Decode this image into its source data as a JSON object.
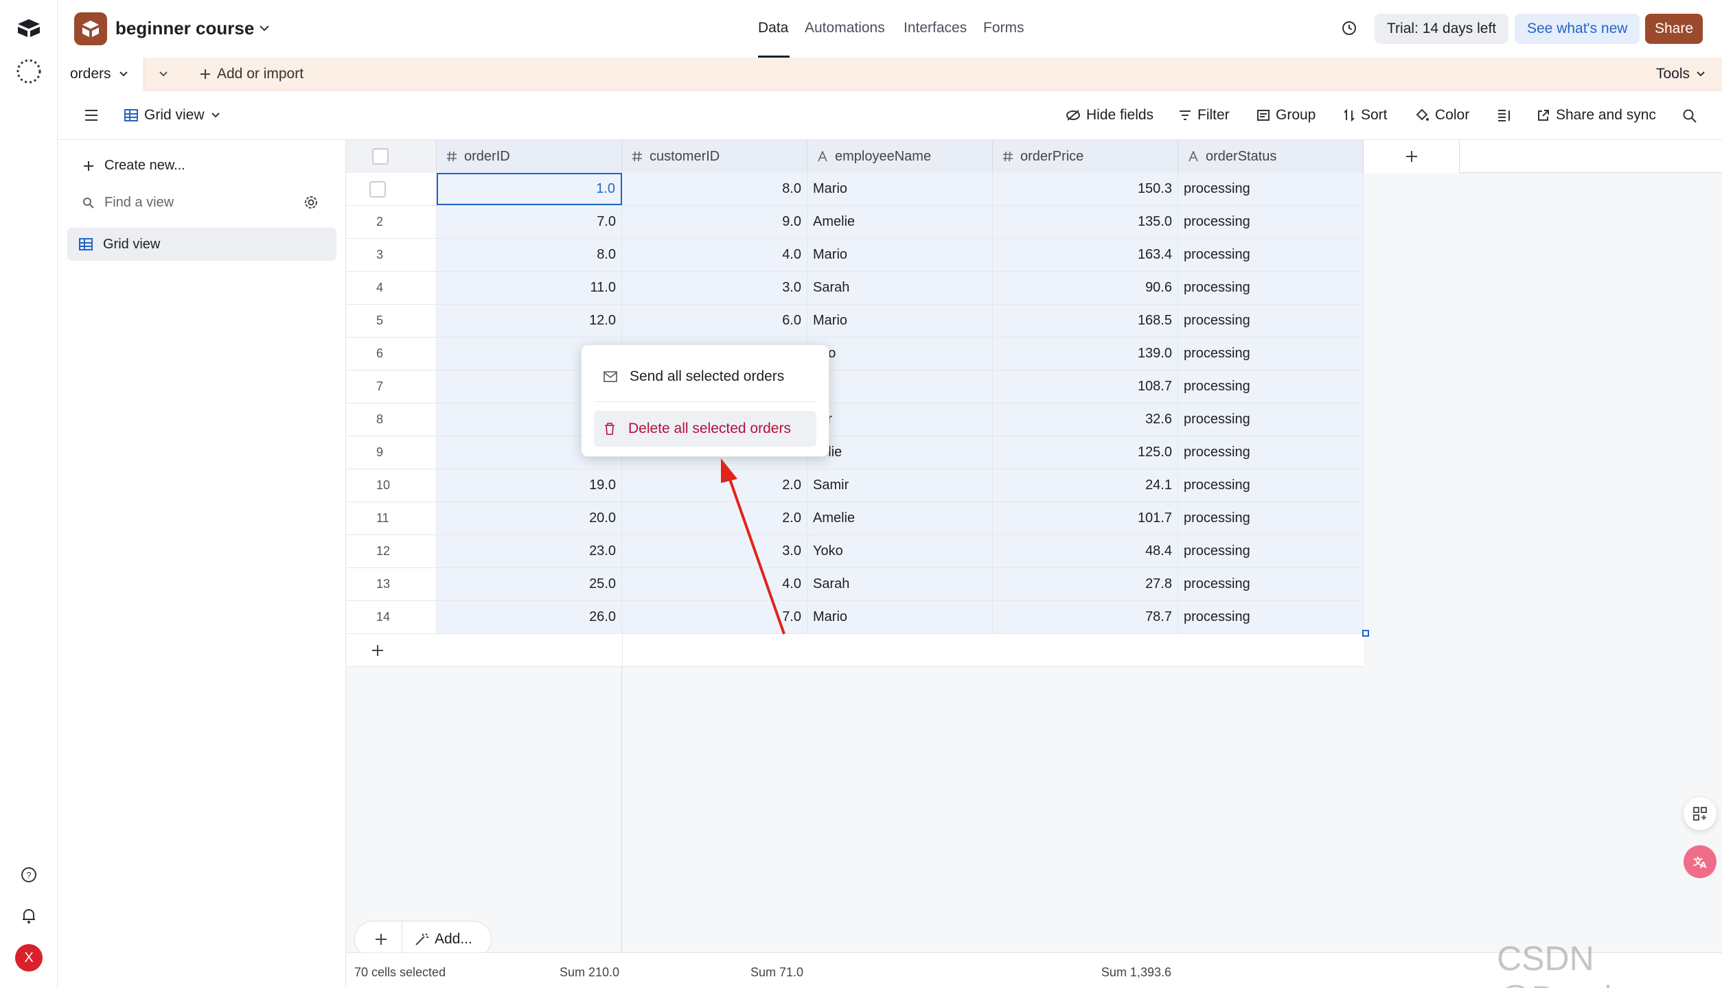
{
  "app": {
    "base_name": "beginner course"
  },
  "top_nav": {
    "tabs": [
      "Data",
      "Automations",
      "Interfaces",
      "Forms"
    ],
    "active": "Data"
  },
  "top_right": {
    "trial": "Trial: 14 days left",
    "whats_new": "See what's new",
    "share": "Share"
  },
  "table_bar": {
    "table_name": "orders",
    "add_import": "Add or import",
    "tools": "Tools"
  },
  "view_bar": {
    "view_name": "Grid view",
    "hide_fields": "Hide fields",
    "filter": "Filter",
    "group": "Group",
    "sort": "Sort",
    "color": "Color",
    "share_sync": "Share and sync"
  },
  "sidebar": {
    "create_new": "Create new...",
    "find_placeholder": "Find a view",
    "views": [
      "Grid view"
    ]
  },
  "columns": [
    "orderID",
    "customerID",
    "employeeName",
    "orderPrice",
    "orderStatus"
  ],
  "rows": [
    {
      "n": "1",
      "orderID": "1.0",
      "customerID": "8.0",
      "employeeName": "Mario",
      "orderPrice": "150.3",
      "orderStatus": "processing"
    },
    {
      "n": "2",
      "orderID": "7.0",
      "customerID": "9.0",
      "employeeName": "Amelie",
      "orderPrice": "135.0",
      "orderStatus": "processing"
    },
    {
      "n": "3",
      "orderID": "8.0",
      "customerID": "4.0",
      "employeeName": "Mario",
      "orderPrice": "163.4",
      "orderStatus": "processing"
    },
    {
      "n": "4",
      "orderID": "11.0",
      "customerID": "3.0",
      "employeeName": "Sarah",
      "orderPrice": "90.6",
      "orderStatus": "processing"
    },
    {
      "n": "5",
      "orderID": "12.0",
      "customerID": "6.0",
      "employeeName": "Mario",
      "orderPrice": "168.5",
      "orderStatus": "processing"
    },
    {
      "n": "6",
      "orderID": "",
      "customerID": "",
      "employeeName": "ario",
      "orderPrice": "139.0",
      "orderStatus": "processing"
    },
    {
      "n": "7",
      "orderID": "",
      "customerID": "",
      "employeeName": "ko",
      "orderPrice": "108.7",
      "orderStatus": "processing"
    },
    {
      "n": "8",
      "orderID": "",
      "customerID": "",
      "employeeName": "mir",
      "orderPrice": "32.6",
      "orderStatus": "processing"
    },
    {
      "n": "9",
      "orderID": "",
      "customerID": "",
      "employeeName": "nelie",
      "orderPrice": "125.0",
      "orderStatus": "processing"
    },
    {
      "n": "10",
      "orderID": "19.0",
      "customerID": "2.0",
      "employeeName": "Samir",
      "orderPrice": "24.1",
      "orderStatus": "processing"
    },
    {
      "n": "11",
      "orderID": "20.0",
      "customerID": "2.0",
      "employeeName": "Amelie",
      "orderPrice": "101.7",
      "orderStatus": "processing"
    },
    {
      "n": "12",
      "orderID": "23.0",
      "customerID": "3.0",
      "employeeName": "Yoko",
      "orderPrice": "48.4",
      "orderStatus": "processing"
    },
    {
      "n": "13",
      "orderID": "25.0",
      "customerID": "4.0",
      "employeeName": "Sarah",
      "orderPrice": "27.8",
      "orderStatus": "processing"
    },
    {
      "n": "14",
      "orderID": "26.0",
      "customerID": "7.0",
      "employeeName": "Mario",
      "orderPrice": "78.7",
      "orderStatus": "processing"
    }
  ],
  "context_menu": {
    "send": "Send all selected orders",
    "delete": "Delete all selected orders"
  },
  "footer": {
    "add_label": "Add...",
    "selected": "70 cells selected",
    "sum_order": "Sum 210.0",
    "sum_customer": "Sum 71.0",
    "sum_price": "Sum 1,393.6"
  },
  "watermark": "CSDN @Dontla",
  "user_initial": "X",
  "colors": {
    "brand": "#9c4a2e",
    "table_bar": "#fcefe6",
    "selection": "#eef3fb",
    "danger": "#b2103f",
    "accent_blue": "#2264c7"
  }
}
